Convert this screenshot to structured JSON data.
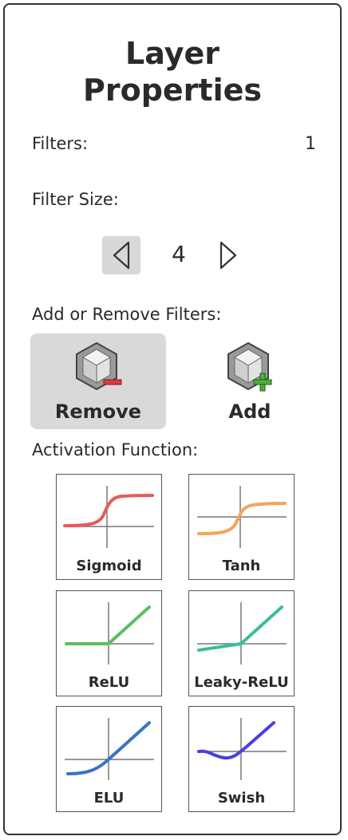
{
  "panel": {
    "title_line1": "Layer",
    "title_line2": "Properties"
  },
  "filters": {
    "label": "Filters:",
    "value": "1"
  },
  "filter_size": {
    "label": "Filter Size:",
    "value": "4"
  },
  "add_remove": {
    "label": "Add or Remove Filters:",
    "remove_label": "Remove",
    "add_label": "Add"
  },
  "activation": {
    "label": "Activation Function:",
    "functions": [
      {
        "label": "Sigmoid",
        "color": "#e8595a"
      },
      {
        "label": "Tanh",
        "color": "#f2a55c"
      },
      {
        "label": "ReLU",
        "color": "#5dbd62"
      },
      {
        "label": "Leaky-ReLU",
        "color": "#39c08f"
      },
      {
        "label": "ELU",
        "color": "#3a73c4"
      },
      {
        "label": "Swish",
        "color": "#4b3de3"
      }
    ]
  },
  "icons": {
    "remove": "cube-minus-icon",
    "add": "cube-plus-icon",
    "prev": "triangle-left-icon",
    "next": "triangle-right-icon"
  }
}
